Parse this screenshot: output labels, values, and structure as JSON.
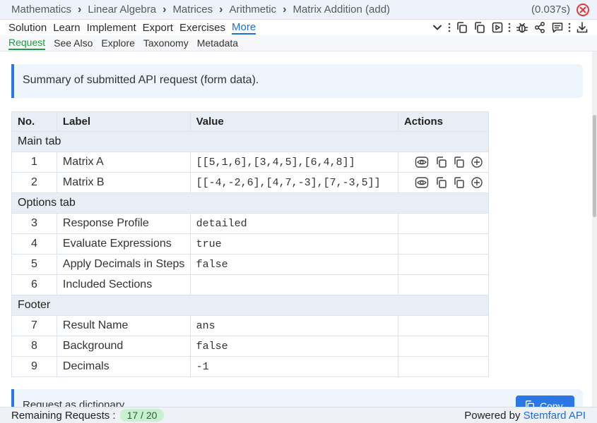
{
  "breadcrumb": {
    "items": [
      "Mathematics",
      "Linear Algebra",
      "Matrices",
      "Arithmetic",
      "Matrix Addition (add)"
    ],
    "timing": "(0.037s)"
  },
  "menu": {
    "items": [
      "Solution",
      "Learn",
      "Implement",
      "Export",
      "Exercises",
      "More"
    ],
    "active": "More"
  },
  "subtabs": {
    "items": [
      "Request",
      "See Also",
      "Explore",
      "Taxonomy",
      "Metadata"
    ],
    "active": "Request"
  },
  "summary_text": "Summary of submitted API request (form data).",
  "table": {
    "headers": [
      "No.",
      "Label",
      "Value",
      "Actions"
    ],
    "sections": [
      {
        "title": "Main tab",
        "rows": [
          {
            "no": "1",
            "label": "Matrix A",
            "value": "[[5,1,6],[3,4,5],[6,4,8]]",
            "actions": true
          },
          {
            "no": "2",
            "label": "Matrix B",
            "value": "[[-4,-2,6],[4,7,-3],[7,-3,5]]",
            "actions": true
          }
        ]
      },
      {
        "title": "Options tab",
        "rows": [
          {
            "no": "3",
            "label": "Response Profile",
            "value": "detailed",
            "actions": false
          },
          {
            "no": "4",
            "label": "Evaluate Expressions",
            "value": "true",
            "actions": false
          },
          {
            "no": "5",
            "label": "Apply Decimals in Steps",
            "value": "false",
            "actions": false
          },
          {
            "no": "6",
            "label": "Included Sections",
            "value": "",
            "actions": false
          }
        ]
      },
      {
        "title": "Footer",
        "rows": [
          {
            "no": "7",
            "label": "Result Name",
            "value": "ans",
            "actions": false
          },
          {
            "no": "8",
            "label": "Background",
            "value": "false",
            "actions": false
          },
          {
            "no": "9",
            "label": "Decimals",
            "value": "-1",
            "actions": false
          }
        ]
      }
    ]
  },
  "dict_box": {
    "title": "Request as dictionary",
    "copy_label": "Copy"
  },
  "footer": {
    "remaining_label": "Remaining Requests :",
    "remaining_value": "17 / 20",
    "powered_prefix": "Powered by",
    "powered_link": "Stemfard API"
  },
  "colors": {
    "accent": "#1e6fd9",
    "active_subtab": "#1f9a45",
    "close": "#e03b3b"
  }
}
